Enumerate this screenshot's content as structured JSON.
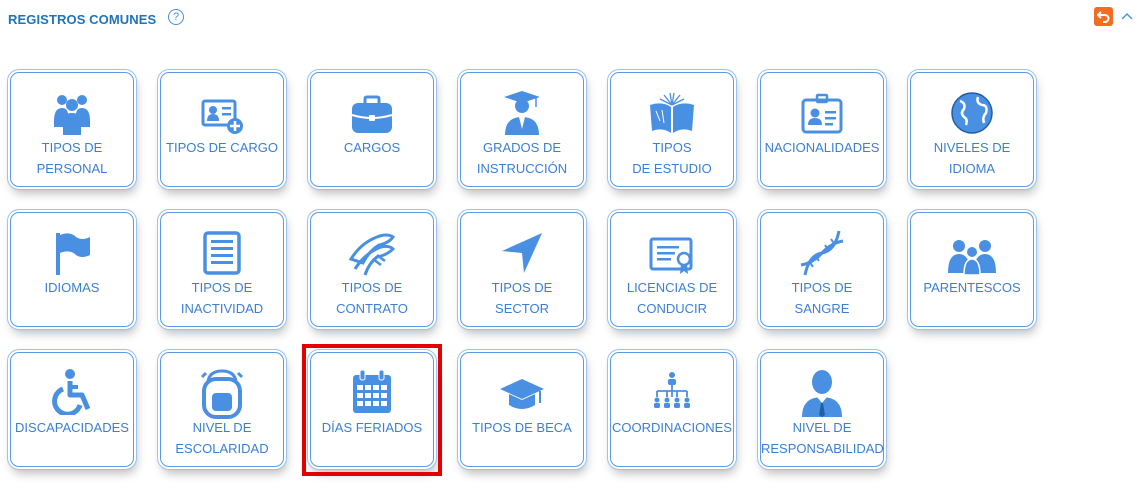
{
  "section": {
    "title": "REGISTROS COMUNES",
    "help_glyph": "?"
  },
  "colors": {
    "accent": "#4a90e2",
    "title": "#1f73b7",
    "back_button": "#f26c22",
    "highlight": "#e30000"
  },
  "tiles": [
    {
      "icon": "users-group-icon",
      "lines": [
        "TIPOS DE",
        "PERSONAL"
      ]
    },
    {
      "icon": "id-card-plus-icon",
      "lines": [
        "TIPOS DE CARGO"
      ]
    },
    {
      "icon": "briefcase-icon",
      "lines": [
        "CARGOS"
      ]
    },
    {
      "icon": "graduate-icon",
      "lines": [
        "GRADOS DE",
        "INSTRUCCIÓN"
      ]
    },
    {
      "icon": "open-book-icon",
      "lines": [
        "TIPOS",
        "DE ESTUDIO"
      ]
    },
    {
      "icon": "badge-icon",
      "lines": [
        "NACIONALIDADES"
      ]
    },
    {
      "icon": "globe-icon",
      "lines": [
        "NIVELES DE",
        "IDIOMA"
      ]
    },
    {
      "icon": "flag-icon",
      "lines": [
        "IDIOMAS"
      ]
    },
    {
      "icon": "document-list-icon",
      "lines": [
        "TIPOS DE",
        "INACTIVIDAD"
      ]
    },
    {
      "icon": "handshake-icon",
      "lines": [
        "TIPOS DE",
        "CONTRATO"
      ]
    },
    {
      "icon": "location-arrow-icon",
      "lines": [
        "TIPOS DE",
        "SECTOR"
      ]
    },
    {
      "icon": "certificate-icon",
      "lines": [
        "LICENCIAS DE",
        "CONDUCIR"
      ]
    },
    {
      "icon": "dna-icon",
      "lines": [
        "TIPOS DE",
        "SANGRE"
      ]
    },
    {
      "icon": "family-icon",
      "lines": [
        "PARENTESCOS"
      ]
    },
    {
      "icon": "wheelchair-icon",
      "lines": [
        "DISCAPACIDADES"
      ]
    },
    {
      "icon": "backpack-icon",
      "lines": [
        "NIVEL DE",
        "ESCOLARIDAD"
      ]
    },
    {
      "icon": "calendar-icon",
      "lines": [
        "DÍAS FERIADOS"
      ]
    },
    {
      "icon": "graduation-cap-icon",
      "lines": [
        "TIPOS DE BECA"
      ]
    },
    {
      "icon": "org-chart-icon",
      "lines": [
        "COORDINACIONES"
      ]
    },
    {
      "icon": "manager-icon",
      "lines": [
        "NIVEL DE",
        "RESPONSABILIDAD"
      ]
    }
  ]
}
